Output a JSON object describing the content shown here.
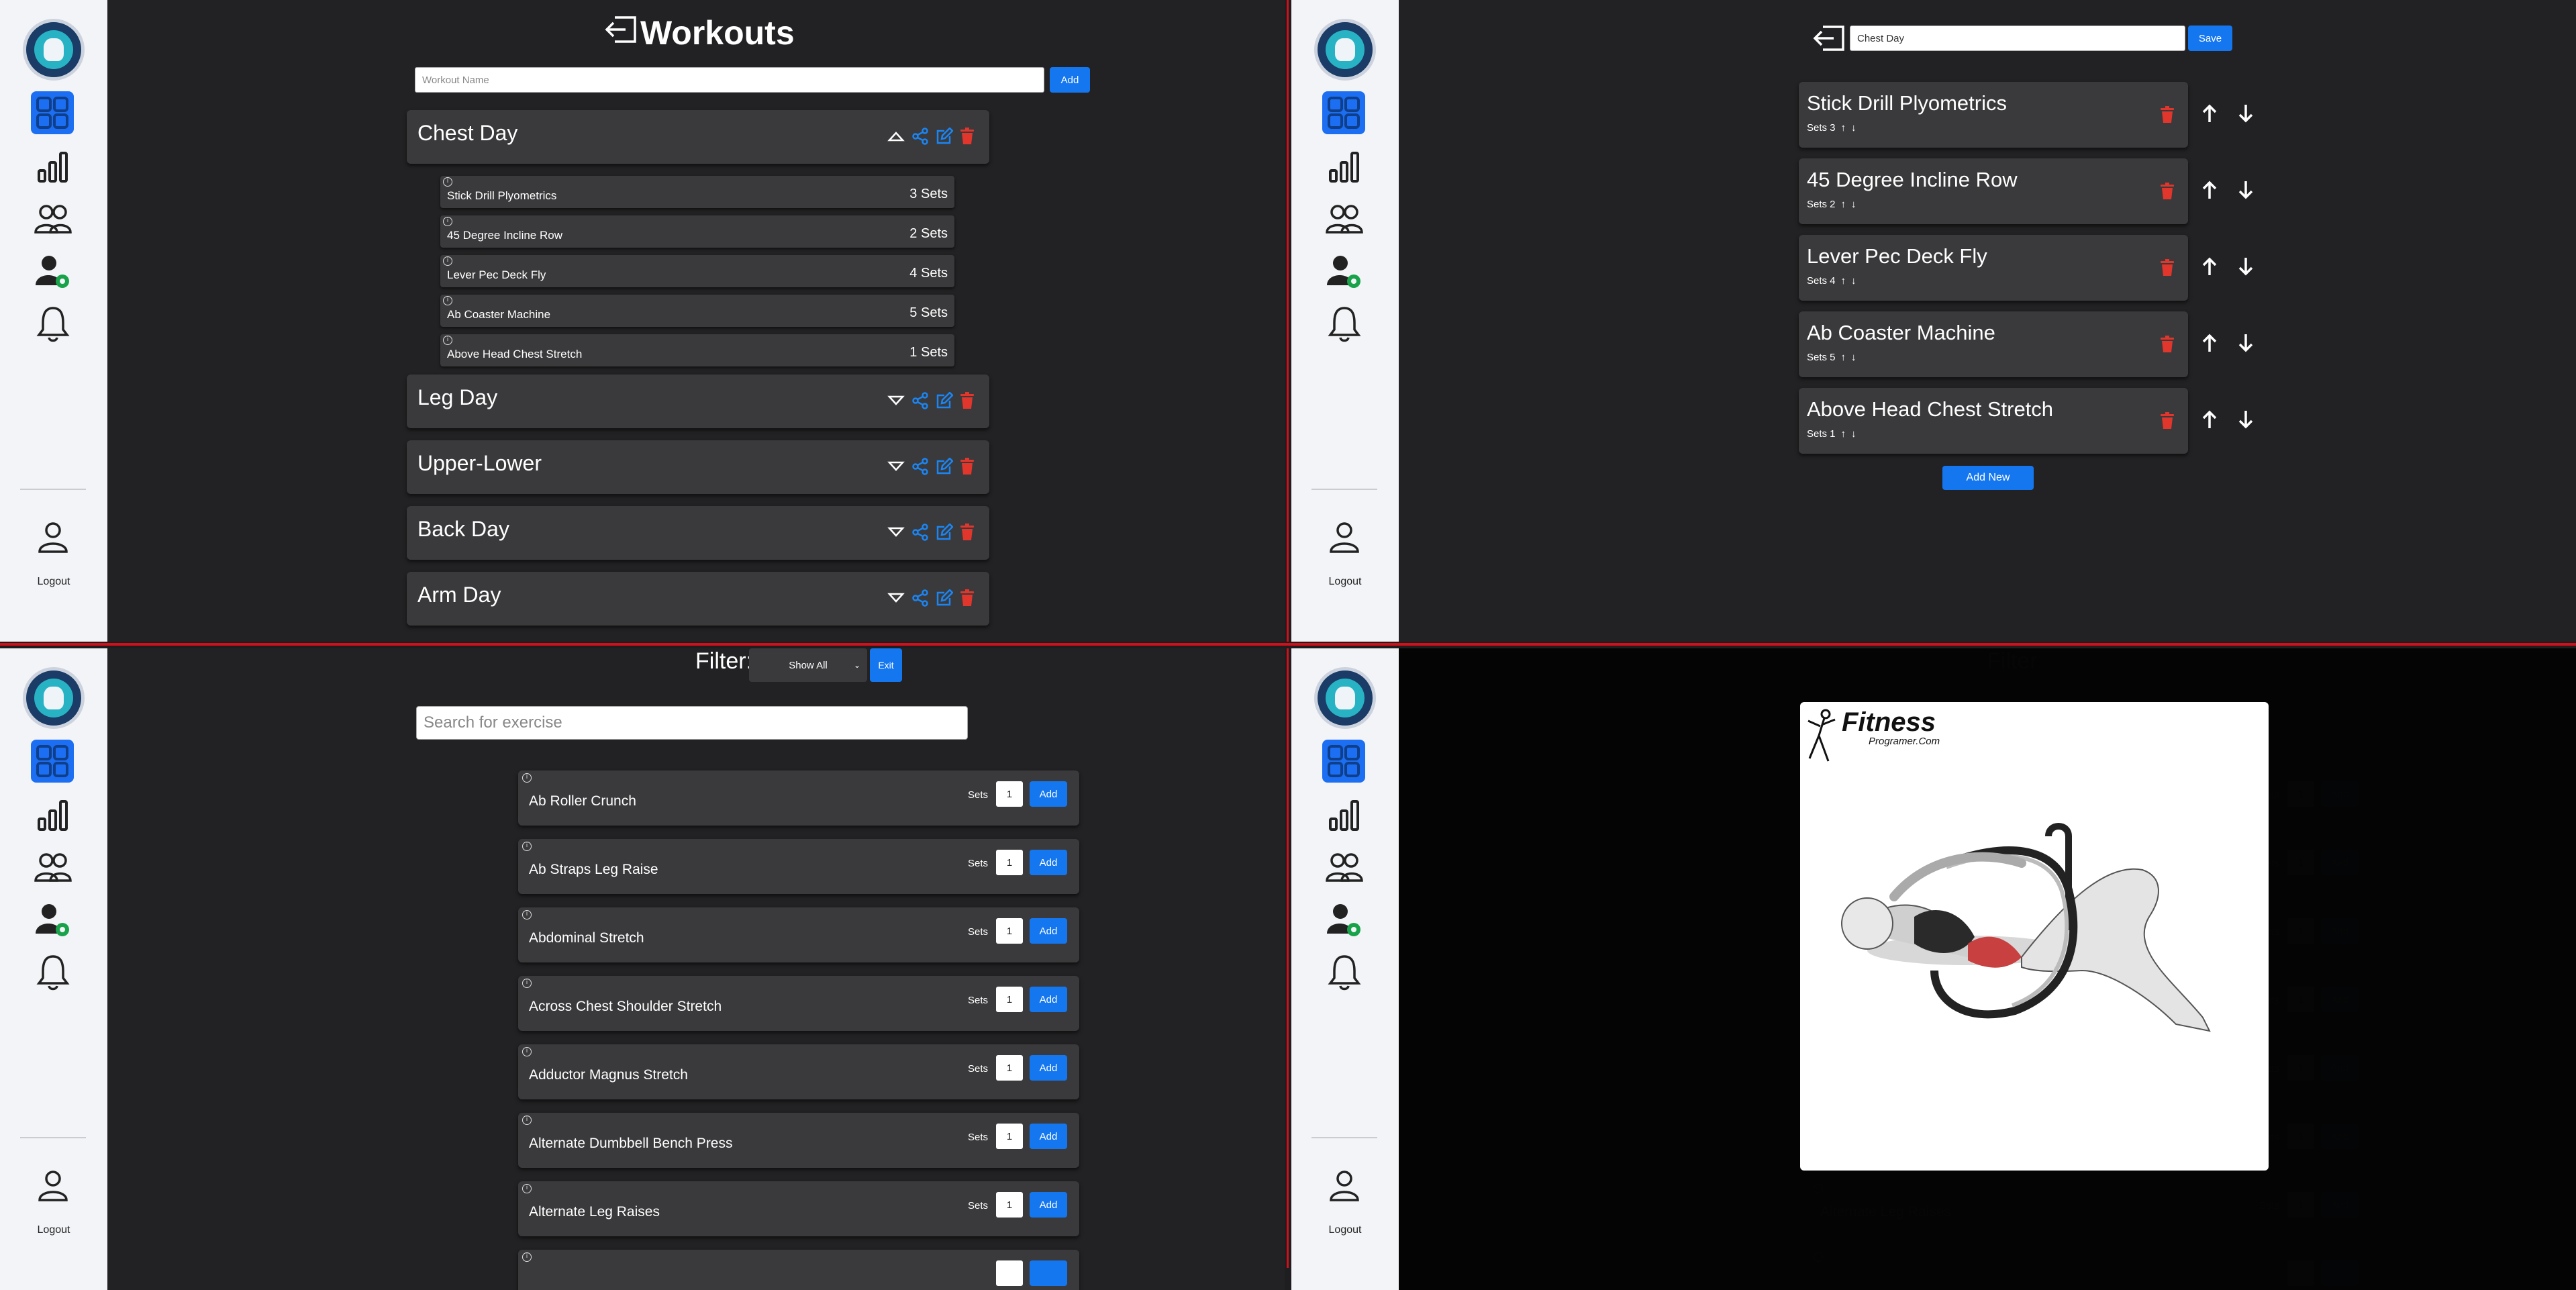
{
  "sidebar": {
    "logout_label": "Logout",
    "icons": [
      "dashboard-icon",
      "stats-icon",
      "friends-icon",
      "user-settings-icon",
      "bell-icon",
      "user-icon"
    ],
    "active_color": "#1c6ff2"
  },
  "workouts_view": {
    "title": "Workouts",
    "name_placeholder": "Workout Name",
    "add_label": "Add",
    "workouts": [
      {
        "name": "Chest Day",
        "expanded": true,
        "exercises": [
          {
            "name": "Stick Drill Plyometrics",
            "sets": "3 Sets"
          },
          {
            "name": "45 Degree Incline Row",
            "sets": "2 Sets"
          },
          {
            "name": "Lever Pec Deck Fly",
            "sets": "4 Sets"
          },
          {
            "name": "Ab Coaster Machine",
            "sets": "5 Sets"
          },
          {
            "name": "Above Head Chest Stretch",
            "sets": "1 Sets"
          }
        ]
      },
      {
        "name": "Leg Day",
        "expanded": false
      },
      {
        "name": "Upper-Lower",
        "expanded": false
      },
      {
        "name": "Back Day",
        "expanded": false
      },
      {
        "name": "Arm Day",
        "expanded": false
      }
    ]
  },
  "editor_view": {
    "workout_name_value": "Chest Day",
    "save_label": "Save",
    "add_new_label": "Add New",
    "exercises": [
      {
        "name": "Stick Drill Plyometrics",
        "sets": "Sets 3"
      },
      {
        "name": "45 Degree Incline Row",
        "sets": "Sets 2"
      },
      {
        "name": "Lever Pec Deck Fly",
        "sets": "Sets 4"
      },
      {
        "name": "Ab Coaster Machine",
        "sets": "Sets 5"
      },
      {
        "name": "Above Head Chest Stretch",
        "sets": "Sets 1"
      }
    ]
  },
  "library_view": {
    "filter_label": "Filter:",
    "filter_selected": "Show All",
    "exit_label": "Exit",
    "search_placeholder": "Search for exercise",
    "sets_label": "Sets",
    "add_label": "Add",
    "exercises": [
      {
        "name": "Ab Roller Crunch",
        "qty": "1"
      },
      {
        "name": "Ab Straps Leg Raise",
        "qty": "1"
      },
      {
        "name": "Abdominal Stretch",
        "qty": "1"
      },
      {
        "name": "Across Chest Shoulder Stretch",
        "qty": "1"
      },
      {
        "name": "Adductor Magnus Stretch",
        "qty": "1"
      },
      {
        "name": "Alternate Dumbbell Bench Press",
        "qty": "1"
      },
      {
        "name": "Alternate Leg Raises",
        "qty": "1"
      }
    ]
  },
  "preview_view": {
    "brand_main": "Fitness",
    "brand_sub": "Programer.Com",
    "background_exercise_visible": "Alternate Leg Raises"
  },
  "colors": {
    "accent": "#1477f0",
    "danger": "#e0362c",
    "card": "#3a3a3c",
    "background": "#222224",
    "divider": "#d0101a"
  }
}
